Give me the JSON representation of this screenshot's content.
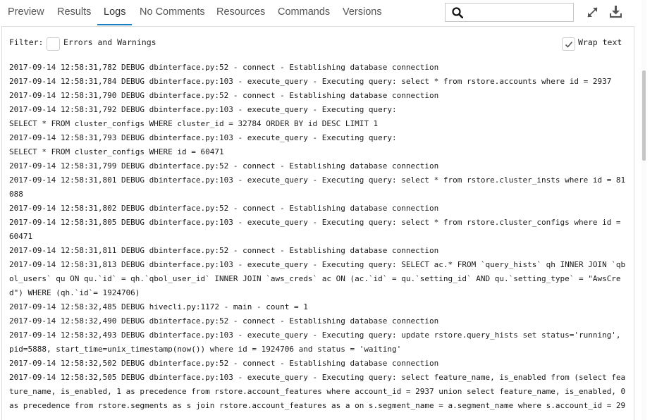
{
  "tabs": [
    {
      "label": "Preview"
    },
    {
      "label": "Results"
    },
    {
      "label": "Logs"
    },
    {
      "label": "No Comments"
    },
    {
      "label": "Resources"
    },
    {
      "label": "Commands"
    },
    {
      "label": "Versions"
    }
  ],
  "active_tab": "Logs",
  "search": {
    "value": "",
    "placeholder": ""
  },
  "icons": {
    "search": "search-icon",
    "expand": "expand-icon",
    "download": "download-icon",
    "check": "check-icon"
  },
  "colors": {
    "active_tab_underline": "#1a7fc1",
    "icon": "#555555",
    "text": "#1a1a1a"
  },
  "filter": {
    "label": "Filter:",
    "option_label": "Errors and Warnings",
    "checked": false
  },
  "wrap_text": {
    "label": "Wrap text",
    "checked": true
  },
  "log_lines": [
    "2017-09-14 12:58:31,782 DEBUG dbinterface.py:52 - connect - Establishing database connection",
    "2017-09-14 12:58:31,784 DEBUG dbinterface.py:103 - execute_query - Executing query: select * from rstore.accounts where id = 2937",
    "2017-09-14 12:58:31,790 DEBUG dbinterface.py:52 - connect - Establishing database connection",
    "2017-09-14 12:58:31,792 DEBUG dbinterface.py:103 - execute_query - Executing query:",
    "SELECT * FROM cluster_configs WHERE cluster_id = 32784 ORDER BY id DESC LIMIT 1",
    "2017-09-14 12:58:31,793 DEBUG dbinterface.py:103 - execute_query - Executing query:",
    "SELECT * FROM cluster_configs WHERE id = 60471",
    "2017-09-14 12:58:31,799 DEBUG dbinterface.py:52 - connect - Establishing database connection",
    "2017-09-14 12:58:31,801 DEBUG dbinterface.py:103 - execute_query - Executing query: select * from rstore.cluster_insts where id = 81",
    "088",
    "2017-09-14 12:58:31,802 DEBUG dbinterface.py:52 - connect - Establishing database connection",
    "2017-09-14 12:58:31,805 DEBUG dbinterface.py:103 - execute_query - Executing query: select * from rstore.cluster_configs where id =",
    "60471",
    "2017-09-14 12:58:31,811 DEBUG dbinterface.py:52 - connect - Establishing database connection",
    "2017-09-14 12:58:31,813 DEBUG dbinterface.py:103 - execute_query - Executing query: SELECT ac.* FROM `query_hists` qh INNER JOIN `qb",
    "ol_users` qu ON qu.`id` = qh.`qbol_user_id` INNER JOIN `aws_creds` ac ON (ac.`id` = qu.`setting_id` AND qu.`setting_type` = \"AwsCre",
    "d\") WHERE (qh.`id`= 1924706)",
    "2017-09-14 12:58:32,485 DEBUG hivecli.py:1172 - main - count = 1",
    "2017-09-14 12:58:32,490 DEBUG dbinterface.py:52 - connect - Establishing database connection",
    "2017-09-14 12:58:32,493 DEBUG dbinterface.py:103 - execute_query - Executing query: update rstore.query_hists set status='running',",
    "pid=5888, start_time=unix_timestamp(now()) where id = 1924706 and status = 'waiting'",
    "2017-09-14 12:58:32,502 DEBUG dbinterface.py:52 - connect - Establishing database connection",
    "2017-09-14 12:58:32,505 DEBUG dbinterface.py:103 - execute_query - Executing query: select feature_name, is_enabled from (select fea",
    "ture_name, is_enabled, 1 as precedence from rstore.account_features where account_id = 2937 union select feature_name, is_enabled, 0",
    "as precedence from rstore.segments as s join rstore.account_features as a on s.segment_name = a.segment_name where s.account_id = 29"
  ]
}
